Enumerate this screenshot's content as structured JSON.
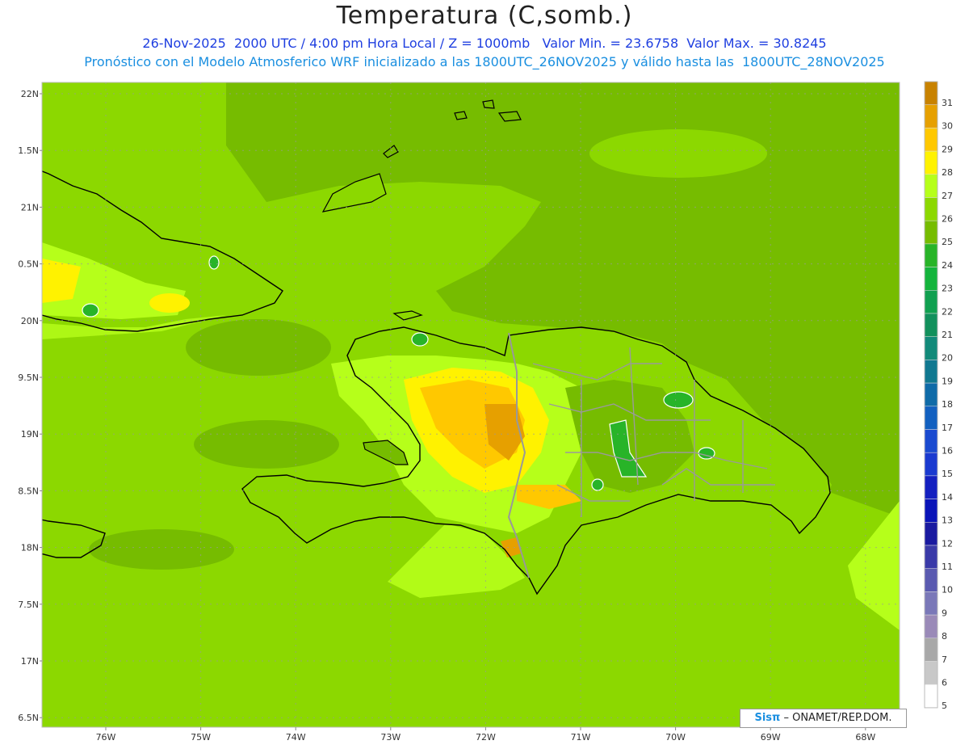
{
  "header": {
    "title": "Temperatura (C,somb.)",
    "line1": "26-Nov-2025  2000 UTC / 4:00 pm Hora Local / Z = 1000mb   Valor Min. = 23.6758  Valor Max. = 30.8245",
    "line2": "Pronóstico con el Modelo Atmosferico WRF inicializado a las 1800UTC_26NOV2025 y válido hasta las  1800UTC_28NOV2025"
  },
  "axes": {
    "lat_labels": [
      "22N",
      "1.5N",
      "21N",
      "0.5N",
      "20N",
      "9.5N",
      "19N",
      "8.5N",
      "18N",
      "7.5N",
      "17N",
      "6.5N"
    ],
    "lon_labels": [
      "76W",
      "75W",
      "74W",
      "73W",
      "72W",
      "71W",
      "70W",
      "69W",
      "68W"
    ]
  },
  "legend": {
    "labels": [
      "31",
      "30",
      "29",
      "28",
      "27",
      "26",
      "25",
      "24",
      "23",
      "22",
      "21",
      "20",
      "19",
      "18",
      "17",
      "16",
      "15",
      "14",
      "13",
      "12",
      "11",
      "10",
      "9",
      "8",
      "7",
      "6",
      "5"
    ],
    "colors": [
      "#c88200",
      "#e6a000",
      "#ffc800",
      "#fff200",
      "#b6ff1a",
      "#8cd800",
      "#76bc00",
      "#28b428",
      "#14b43c",
      "#10a050",
      "#12905c",
      "#128a7a",
      "#107890",
      "#0f6ba8",
      "#1260c0",
      "#1a4ad0",
      "#1a3ad0",
      "#1420c0",
      "#0a14b8",
      "#1a1aa0",
      "#3a3aa8",
      "#5a5ab0",
      "#7a78b8",
      "#9a8ab8",
      "#a8a8a8",
      "#c8c8c8",
      "#ffffff"
    ]
  },
  "credit": {
    "brand": "Sisπ",
    "text": "– ONAMET/REP.DOM."
  }
}
